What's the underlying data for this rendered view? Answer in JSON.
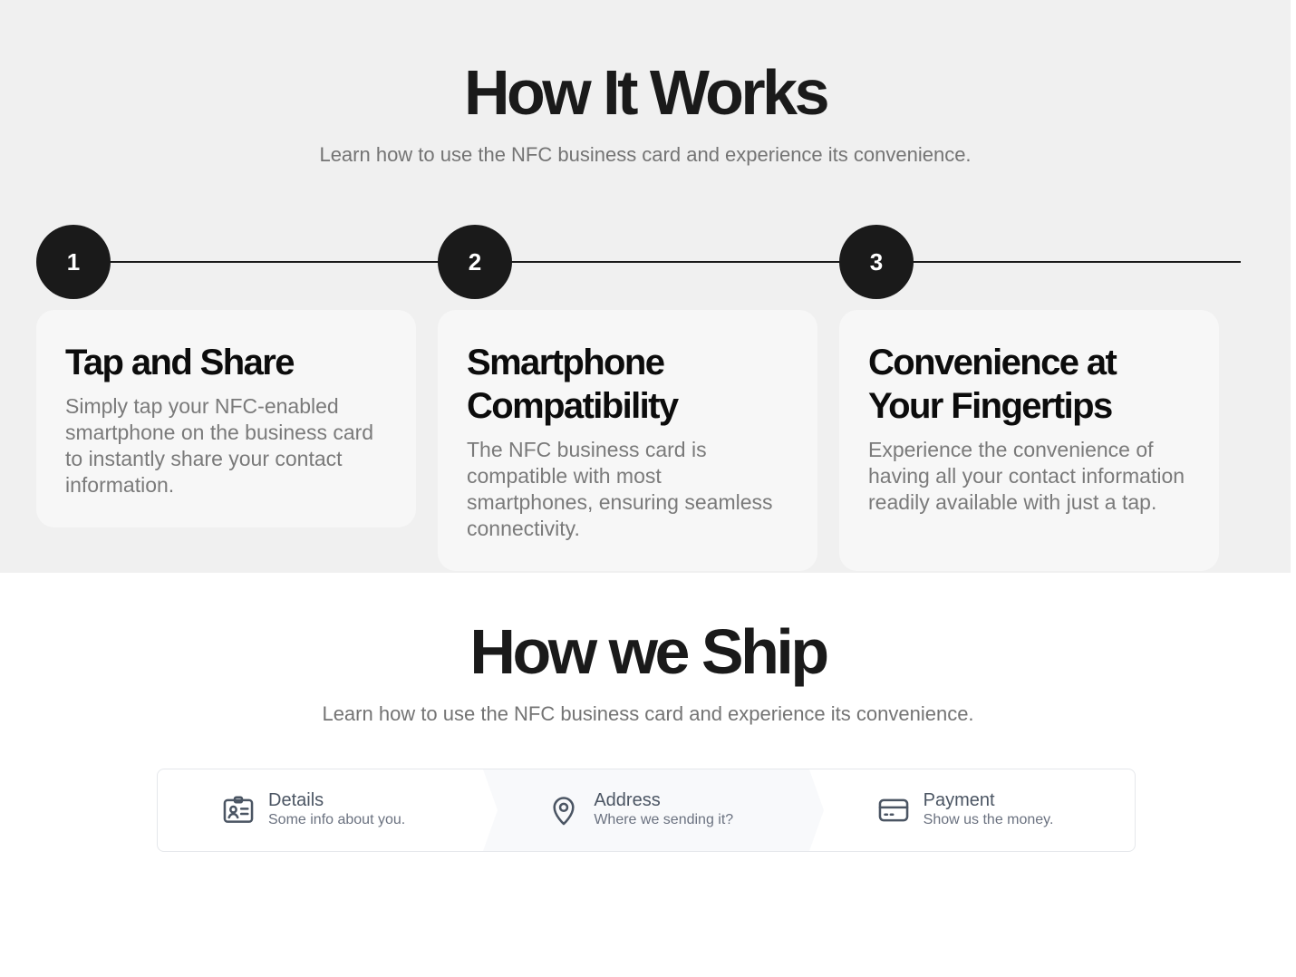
{
  "how_it_works": {
    "title": "How It Works",
    "subtitle": "Learn how to use the NFC business card and experience its convenience.",
    "steps": [
      {
        "number": "1",
        "title": "Tap and Share",
        "description": "Simply tap your NFC-enabled smartphone on the business card to instantly share your contact information."
      },
      {
        "number": "2",
        "title": "Smartphone Compatibility",
        "description": "The NFC business card is compatible with most smartphones, ensuring seamless connectivity."
      },
      {
        "number": "3",
        "title": "Convenience at Your Fingertips",
        "description": "Experience the convenience of having all your contact information readily available with just a tap."
      }
    ]
  },
  "how_we_ship": {
    "title": "How we Ship",
    "subtitle": "Learn how to use the NFC business card and experience its convenience.",
    "steps": [
      {
        "icon": "id-card-icon",
        "label": "Details",
        "sublabel": "Some info about you.",
        "active": false
      },
      {
        "icon": "map-pin-icon",
        "label": "Address",
        "sublabel": "Where we sending it?",
        "active": true
      },
      {
        "icon": "credit-card-icon",
        "label": "Payment",
        "sublabel": "Show us the money.",
        "active": false
      }
    ]
  },
  "colors": {
    "section_bg": "#f0f0f0",
    "card_bg": "#f7f7f7",
    "dark": "#1a1a1a",
    "muted_text": "#7a7a7a",
    "icon": "#4b5563"
  }
}
